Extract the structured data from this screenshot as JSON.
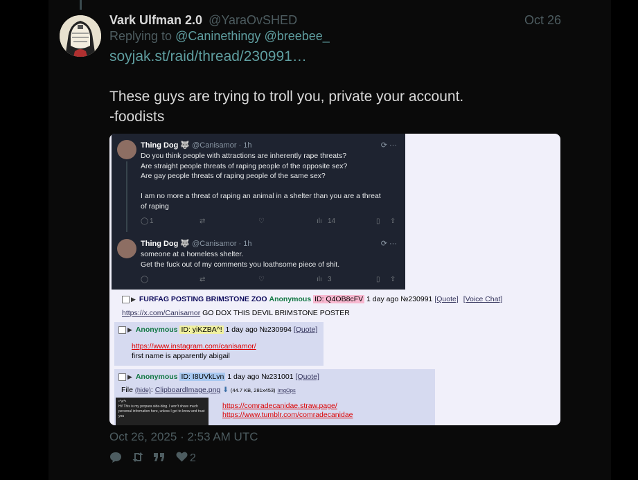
{
  "post": {
    "display_name": "Vark Ulfman 2.0",
    "handle": "@YaraOvSHED",
    "date": "Oct 26",
    "replying_prefix": "Replying to",
    "mention_1": "@Caninethingy",
    "mention_2": "@breebee_",
    "link": "soyjak.st/raid/thread/230991…",
    "body": "These guys are trying to troll you, private your account.\n-foodists",
    "timestamp": "Oct 26, 2025 · 2:53 AM UTC",
    "like_count": "2"
  },
  "screenshot": {
    "tweet1": {
      "name": "Thing Dog 🐺",
      "handle": "@Canisamor · 1h",
      "text": "Do you think people with attractions are inherently rape threats?\nAre straight people threats of raping people of the opposite sex?\nAre gay people threats of raping people of the same sex?\n\nI am no more a threat of raping an animal in a shelter than you are a threat\nof raping",
      "reply_count": "1",
      "views": "14"
    },
    "tweet2": {
      "name": "Thing Dog 🐺",
      "handle": "@Canisamor · 1h",
      "text": "someone at a homeless shelter.\nGet the fuck out of my comments you loathsome piece of shit.",
      "views": "3"
    },
    "op": {
      "subject": "FURFAG POSTING BRIMSTONE ZOO",
      "name": "Anonymous",
      "id": "ID: Q4OB8cFV",
      "time": "1 day ago",
      "number": "№230991",
      "quote": "[Quote]",
      "voice": "[Voice Chat]",
      "body_link": "https://x.com/Canisamor",
      "body_text": "GO DOX THIS DEVIL BRIMSTONE POSTER"
    },
    "reply1": {
      "name": "Anonymous",
      "id": "ID: yiKZBA^!",
      "time": "1 day ago",
      "number": "№230994",
      "quote": "[Quote]",
      "link": "https://www.instagram.com/canisamor/",
      "text": "first name is apparently abigail"
    },
    "reply2": {
      "name": "Anonymous",
      "id": "ID: I8UVkLvn",
      "time": "1 day ago",
      "number": "№231001",
      "quote": "[Quote]",
      "file_label": "File",
      "file_hide": "(hide)",
      "file_name": "ClipboardImage.png",
      "file_meta": "(44.7 KB, 281x453)",
      "file_imgops": "ImgOps",
      "link1": "https://comradecanidae.straw.page/",
      "link2": "https://www.tumblr.com/comradecanidae",
      "thumb_title": "ᶜ*w*ᵃ",
      "thumb_text": "Hi! This is my propara side-blog. I won't share much personal information here, unless I get to know and trust you"
    }
  },
  "colors": {
    "accent_link": "#5f9ea0",
    "muted": "#4d5c60",
    "background": "#000000"
  },
  "icons": [
    "comment-icon",
    "retweet-icon",
    "quote-icon",
    "heart-icon"
  ]
}
